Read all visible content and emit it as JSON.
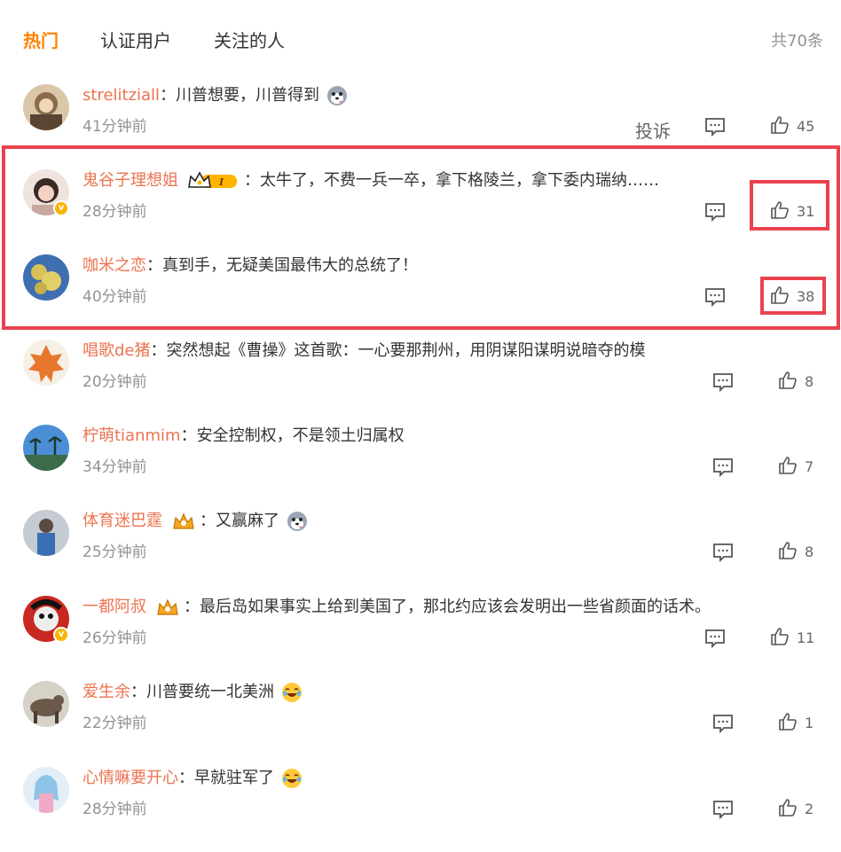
{
  "tabs": [
    {
      "label": "热门",
      "active": true
    },
    {
      "label": "认证用户",
      "active": false
    },
    {
      "label": "关注的人",
      "active": false
    }
  ],
  "total_label": "共70条",
  "report_label": "投诉",
  "colors": {
    "accent": "#ff8200",
    "username": "#eb7350",
    "highlight": "#e8434e",
    "muted": "#939393"
  },
  "comments": [
    {
      "user": "strelitziall",
      "sep": "：",
      "text": "川普想要，川普得到",
      "time": "41分钟前",
      "likes": "45",
      "emoji": "husky-emoji-icon"
    },
    {
      "user": "鬼谷子理想姐",
      "sep": "：",
      "text": "太牛了，不费一兵一卒，拿下格陵兰，拿下委内瑞纳……",
      "time": "28分钟前",
      "likes": "31",
      "badge": "crown-level-badge",
      "verified": true
    },
    {
      "user": "咖米之恋",
      "sep": "：",
      "text": "真到手，无疑美国最伟大的总统了！",
      "time": "40分钟前",
      "likes": "38"
    },
    {
      "user": "唱歌de猪",
      "sep": "：",
      "text": "突然想起《曹操》这首歌：一心要那荆州，用阴谋阳谋明说暗夺的模",
      "time": "20分钟前",
      "likes": "8"
    },
    {
      "user": "柠萌tianmim",
      "sep": "：",
      "text": "安全控制权，不是领土归属权",
      "time": "34分钟前",
      "likes": "7"
    },
    {
      "user": "体育迷巴霆",
      "sep": "：",
      "text": "又赢麻了",
      "time": "25分钟前",
      "likes": "8",
      "badge": "fan-crown-badge",
      "emoji": "husky-emoji-icon"
    },
    {
      "user": "一都阿叔",
      "sep": "：",
      "text": "最后岛如果事实上给到美国了，那北约应该会发明出一些省颜面的话术。",
      "time": "26分钟前",
      "likes": "11",
      "badge": "fan-crown-badge",
      "verified": true
    },
    {
      "user": "爱生余",
      "sep": "：",
      "text": "川普要统一北美洲",
      "time": "22分钟前",
      "likes": "1",
      "emoji": "laugh-cry-emoji-icon"
    },
    {
      "user": "心情嘛要开心",
      "sep": "：",
      "text": "早就驻军了",
      "time": "28分钟前",
      "likes": "2",
      "emoji": "laugh-cry-emoji-icon"
    }
  ]
}
